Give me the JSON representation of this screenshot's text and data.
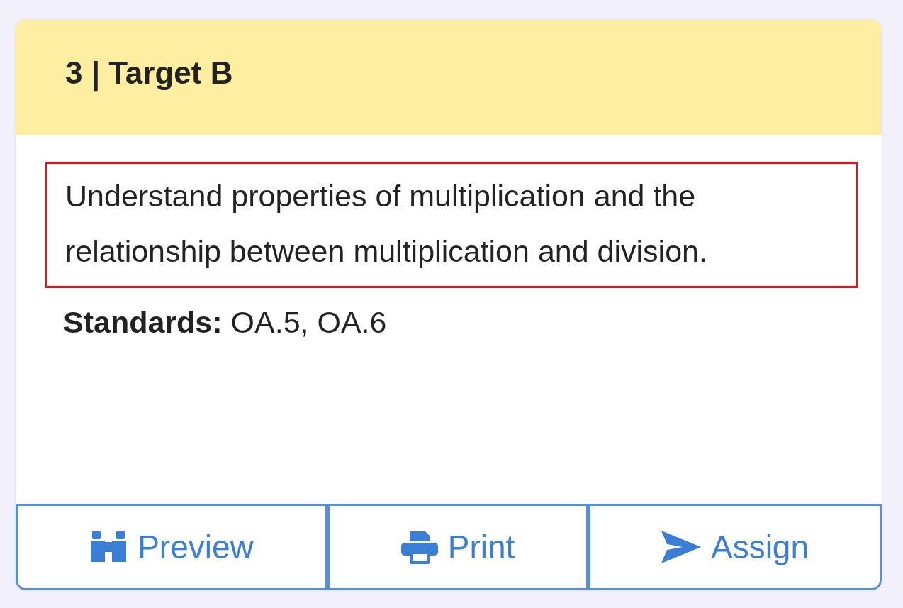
{
  "card": {
    "title": "3 | Target B",
    "description": {
      "text": "Understand properties of multiplication and the relationship between multiplication and division.",
      "highlighted": true
    },
    "standards": "**Standards:** OA.5, OA.6",
    "actions": [
      {
        "kind": "preview",
        "label": "Preview"
      },
      {
        "kind": "print",
        "label": "Print"
      },
      {
        "kind": "assign",
        "label": "Assign"
      }
    ]
  }
}
